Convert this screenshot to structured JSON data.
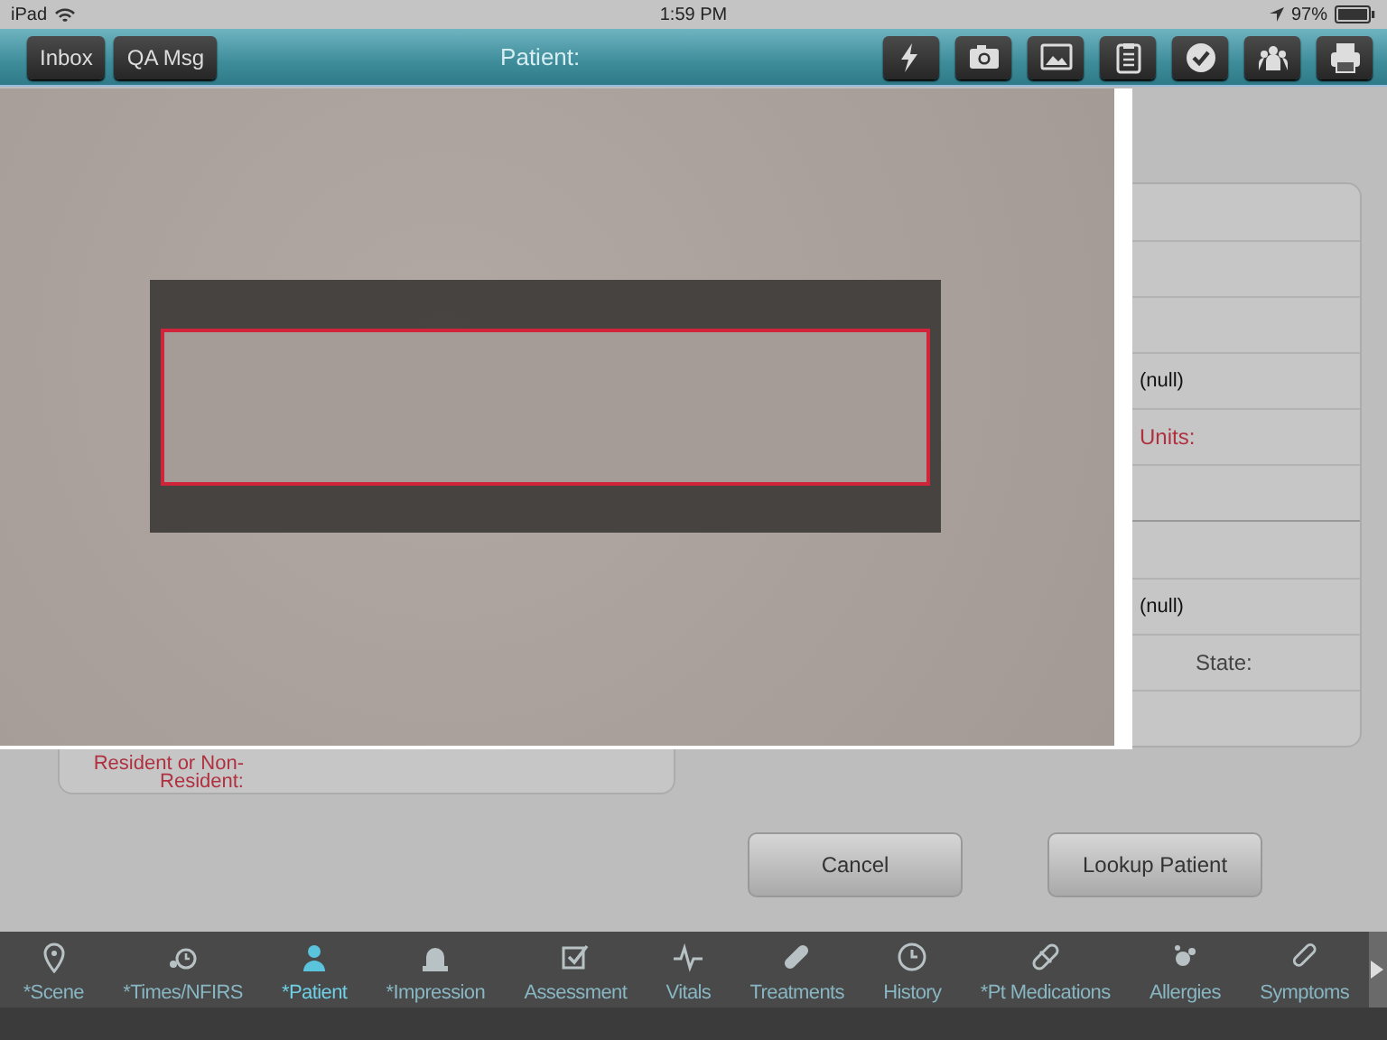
{
  "status_bar": {
    "device": "iPad",
    "time": "1:59 PM",
    "battery": "97%"
  },
  "toolbar": {
    "buttons": [
      "Inbox",
      "QA Msg"
    ],
    "title": "Patient:"
  },
  "left_panel": {
    "rows": [
      {
        "kind": "label",
        "label": "Resident or Non-Resident:",
        "required": true
      }
    ]
  },
  "right_panel": {
    "groups": [
      [
        {
          "kind": "blank"
        },
        {
          "kind": "blank"
        },
        {
          "kind": "blank"
        },
        {
          "kind": "value",
          "value": "(null)"
        },
        {
          "kind": "label",
          "label": "Units:",
          "required": true
        },
        {
          "kind": "blank"
        }
      ],
      [
        {
          "kind": "blank"
        },
        {
          "kind": "value",
          "value": "(null)"
        },
        {
          "kind": "label",
          "label": "State:",
          "required": false
        },
        {
          "kind": "blank"
        }
      ]
    ]
  },
  "buttons": [
    "Cancel",
    "Lookup Patient"
  ],
  "tabs": [
    {
      "label": "*Scene",
      "selected": false
    },
    {
      "label": "*Times/NFIRS",
      "selected": false
    },
    {
      "label": "*Patient",
      "selected": true
    },
    {
      "label": "*Impression",
      "selected": false
    },
    {
      "label": "Assessment",
      "selected": false
    },
    {
      "label": "Vitals",
      "selected": false
    },
    {
      "label": "Treatments",
      "selected": false
    },
    {
      "label": "History",
      "selected": false
    },
    {
      "label": "*Pt Medications",
      "selected": false
    },
    {
      "label": "Allergies",
      "selected": false
    },
    {
      "label": "Symptoms",
      "selected": false
    }
  ]
}
